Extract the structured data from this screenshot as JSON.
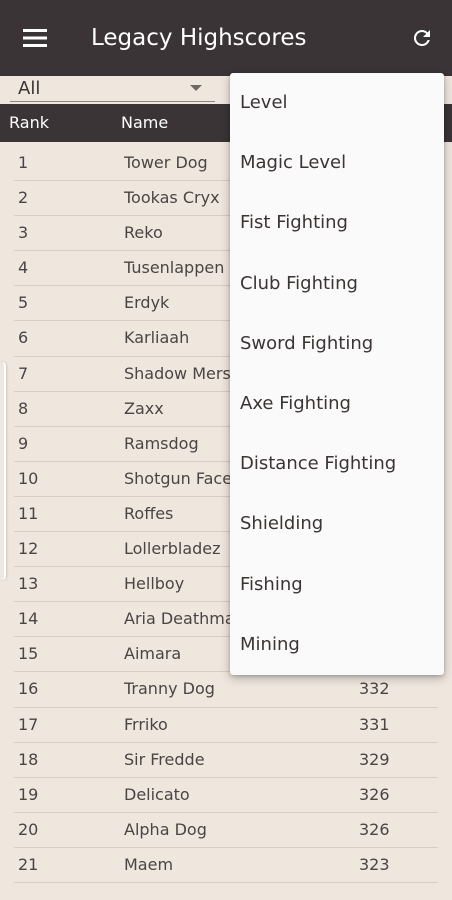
{
  "appbar": {
    "title": "Legacy Highscores",
    "menu_icon": "hamburger-menu-icon",
    "refresh_icon": "refresh-icon",
    "background": "#3a3436"
  },
  "filter": {
    "selected": "All"
  },
  "table": {
    "headers": {
      "rank": "Rank",
      "name": "Name"
    },
    "rows": [
      {
        "rank": "1",
        "name": "Tower Dog",
        "value": ""
      },
      {
        "rank": "2",
        "name": "Tookas Cryx",
        "value": ""
      },
      {
        "rank": "3",
        "name": "Reko",
        "value": ""
      },
      {
        "rank": "4",
        "name": "Tusenlappen",
        "value": ""
      },
      {
        "rank": "5",
        "name": "Erdyk",
        "value": ""
      },
      {
        "rank": "6",
        "name": "Karliaah",
        "value": ""
      },
      {
        "rank": "7",
        "name": "Shadow Mers",
        "value": ""
      },
      {
        "rank": "8",
        "name": "Zaxx",
        "value": ""
      },
      {
        "rank": "9",
        "name": "Ramsdog",
        "value": ""
      },
      {
        "rank": "10",
        "name": "Shotgun Face",
        "value": ""
      },
      {
        "rank": "11",
        "name": "Roffes",
        "value": ""
      },
      {
        "rank": "12",
        "name": "Lollerbladez",
        "value": ""
      },
      {
        "rank": "13",
        "name": "Hellboy",
        "value": ""
      },
      {
        "rank": "14",
        "name": "Aria Deathma",
        "value": ""
      },
      {
        "rank": "15",
        "name": "Aimara",
        "value": ""
      },
      {
        "rank": "16",
        "name": "Tranny Dog",
        "value": "332"
      },
      {
        "rank": "17",
        "name": "Frriko",
        "value": "331"
      },
      {
        "rank": "18",
        "name": "Sir Fredde",
        "value": "329"
      },
      {
        "rank": "19",
        "name": "Delicato",
        "value": "326"
      },
      {
        "rank": "20",
        "name": "Alpha Dog",
        "value": "326"
      },
      {
        "rank": "21",
        "name": "Maem",
        "value": "323"
      }
    ]
  },
  "dropdown": {
    "options": [
      "Level",
      "Magic Level",
      "Fist Fighting",
      "Club Fighting",
      "Sword Fighting",
      "Axe Fighting",
      "Distance Fighting",
      "Shielding",
      "Fishing",
      "Mining"
    ]
  }
}
